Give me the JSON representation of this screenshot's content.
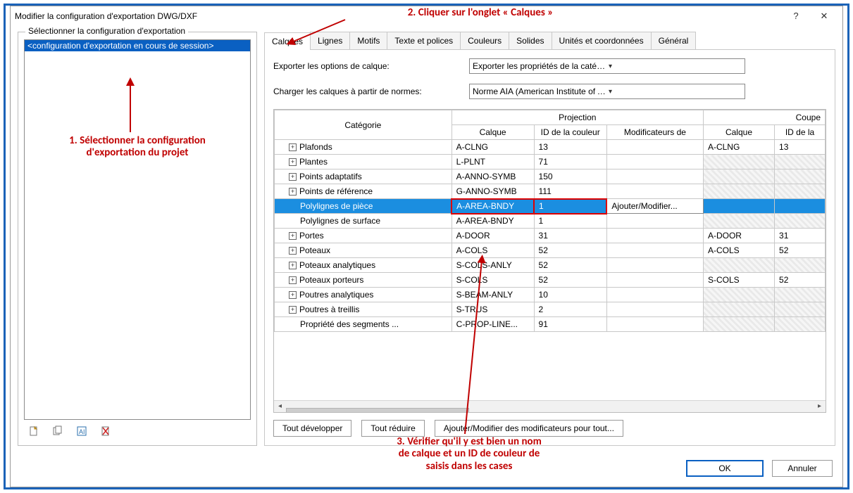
{
  "window": {
    "title": "Modifier la configuration d'exportation DWG/DXF"
  },
  "left": {
    "caption": "Sélectionner la configuration d'exportation",
    "selected_item": "<configuration d'exportation en cours de session>",
    "icons": [
      "new-icon",
      "duplicate-icon",
      "rename-icon",
      "delete-icon"
    ]
  },
  "tabs": {
    "items": [
      "Calques",
      "Lignes",
      "Motifs",
      "Texte et polices",
      "Couleurs",
      "Solides",
      "Unités et coordonnées",
      "Général"
    ],
    "active": 0
  },
  "options": {
    "export_label": "Exporter les options de calque:",
    "export_value": "Exporter les propriétés de la catégorie BYLAYER et les remplacer",
    "norms_label": "Charger les calques à partir de normes:",
    "norms_value": "Norme AIA (American Institute of Architects)"
  },
  "table": {
    "header": {
      "category": "Catégorie",
      "projection": "Projection",
      "coupe": "Coupe",
      "calque": "Calque",
      "id_couleur": "ID de la couleur",
      "modificateurs": "Modificateurs de",
      "id_la": "ID de la"
    },
    "rows": [
      {
        "expand": "+",
        "cat": "Plafonds",
        "l1": "A-CLNG",
        "id1": "13",
        "mod": "",
        "l2": "A-CLNG",
        "id2": "13",
        "sel": false,
        "hatch": false
      },
      {
        "expand": "+",
        "cat": "Plantes",
        "l1": "L-PLNT",
        "id1": "71",
        "mod": "",
        "l2": "",
        "id2": "",
        "sel": false,
        "hatch": true
      },
      {
        "expand": "+",
        "cat": "Points adaptatifs",
        "l1": "A-ANNO-SYMB",
        "id1": "150",
        "mod": "",
        "l2": "",
        "id2": "",
        "sel": false,
        "hatch": true
      },
      {
        "expand": "+",
        "cat": "Points de référence",
        "l1": "G-ANNO-SYMB",
        "id1": "111",
        "mod": "",
        "l2": "",
        "id2": "",
        "sel": false,
        "hatch": true
      },
      {
        "expand": "",
        "cat": "Polylignes de pièce",
        "l1": "A-AREA-BNDY",
        "id1": "1",
        "mod": "Ajouter/Modifier...",
        "l2": "",
        "id2": "",
        "sel": true,
        "hatch": true,
        "red": true
      },
      {
        "expand": "",
        "cat": "Polylignes de surface",
        "l1": "A-AREA-BNDY",
        "id1": "1",
        "mod": "",
        "l2": "",
        "id2": "",
        "sel": false,
        "hatch": true
      },
      {
        "expand": "+",
        "cat": "Portes",
        "l1": "A-DOOR",
        "id1": "31",
        "mod": "",
        "l2": "A-DOOR",
        "id2": "31",
        "sel": false,
        "hatch": false
      },
      {
        "expand": "+",
        "cat": "Poteaux",
        "l1": "A-COLS",
        "id1": "52",
        "mod": "",
        "l2": "A-COLS",
        "id2": "52",
        "sel": false,
        "hatch": false
      },
      {
        "expand": "+",
        "cat": "Poteaux analytiques",
        "l1": "S-COLS-ANLY",
        "id1": "52",
        "mod": "",
        "l2": "",
        "id2": "",
        "sel": false,
        "hatch": true
      },
      {
        "expand": "+",
        "cat": "Poteaux porteurs",
        "l1": "S-COLS",
        "id1": "52",
        "mod": "",
        "l2": "S-COLS",
        "id2": "52",
        "sel": false,
        "hatch": false
      },
      {
        "expand": "+",
        "cat": "Poutres analytiques",
        "l1": "S-BEAM-ANLY",
        "id1": "10",
        "mod": "",
        "l2": "",
        "id2": "",
        "sel": false,
        "hatch": true
      },
      {
        "expand": "+",
        "cat": "Poutres à treillis",
        "l1": "S-TRUS",
        "id1": "2",
        "mod": "",
        "l2": "",
        "id2": "",
        "sel": false,
        "hatch": true
      },
      {
        "expand": "",
        "cat": "Propriété des segments ...",
        "l1": "C-PROP-LINE...",
        "id1": "91",
        "mod": "",
        "l2": "",
        "id2": "",
        "sel": false,
        "hatch": true
      }
    ]
  },
  "buttons": {
    "expand_all": "Tout développer",
    "collapse_all": "Tout réduire",
    "add_modify": "Ajouter/Modifier des modificateurs pour tout...",
    "ok": "OK",
    "cancel": "Annuler"
  },
  "annotations": {
    "step1": "1. Sélectionner la configuration\nd'exportation du projet",
    "step2": "2. Cliquer sur l'onglet « Calques »",
    "step3": "3. Vérifier qu'il y est bien un nom\nde calque et un ID de couleur de\nsaisis dans les cases"
  }
}
